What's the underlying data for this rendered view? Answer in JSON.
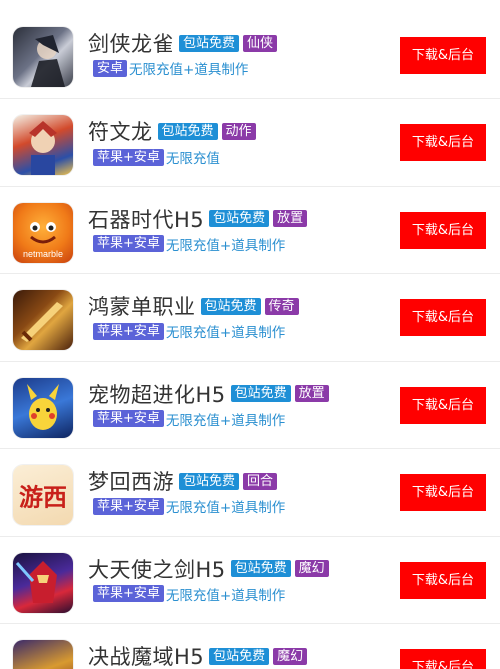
{
  "games": [
    {
      "name": "剑侠龙雀",
      "free_tag": "包站免费",
      "genre": "仙侠",
      "platform": "安卓",
      "features": "无限充值+道具制作",
      "button": "下载&后台",
      "icon": "warrior-portrait-icon"
    },
    {
      "name": "符文龙",
      "free_tag": "包站免费",
      "genre": "动作",
      "platform": "苹果+安卓",
      "features": "无限充值",
      "button": "下载&后台",
      "icon": "armored-hero-icon"
    },
    {
      "name": "石器时代H5",
      "free_tag": "包站免费",
      "genre": "放置",
      "platform": "苹果+安卓",
      "features": "无限充值+道具制作",
      "button": "下载&后台",
      "icon": "netmarble-dragon-icon",
      "icon_text": "netmarble"
    },
    {
      "name": "鸿蒙单职业",
      "free_tag": "包站免费",
      "genre": "传奇",
      "platform": "苹果+安卓",
      "features": "无限充值+道具制作",
      "button": "下载&后台",
      "icon": "golden-sword-icon"
    },
    {
      "name": "宠物超进化H5",
      "free_tag": "包站免费",
      "genre": "放置",
      "platform": "苹果+安卓",
      "features": "无限充值+道具制作",
      "button": "下载&后台",
      "icon": "yellow-pet-icon"
    },
    {
      "name": "梦回西游",
      "free_tag": "包站免费",
      "genre": "回合",
      "platform": "苹果+安卓",
      "features": "无限充值+道具制作",
      "button": "下载&后台",
      "icon": "journey-west-logo-icon",
      "icon_text": "游西"
    },
    {
      "name": "大天使之剑H5",
      "free_tag": "包站免费",
      "genre": "魔幻",
      "platform": "苹果+安卓",
      "features": "无限充值+道具制作",
      "button": "下载&后台",
      "icon": "red-armor-knight-icon"
    },
    {
      "name": "决战魔域H5",
      "free_tag": "包站免费",
      "genre": "魔幻",
      "platform": "",
      "features": "",
      "button": "下载&后台",
      "icon": "golden-warrior-icon"
    }
  ],
  "colors": {
    "button": "#ff0000",
    "free_tag": "#1e8fd6",
    "genre_tag": "#8b3aa8",
    "platform_tag": "#5b63d8",
    "features_text": "#2a8fd0"
  }
}
